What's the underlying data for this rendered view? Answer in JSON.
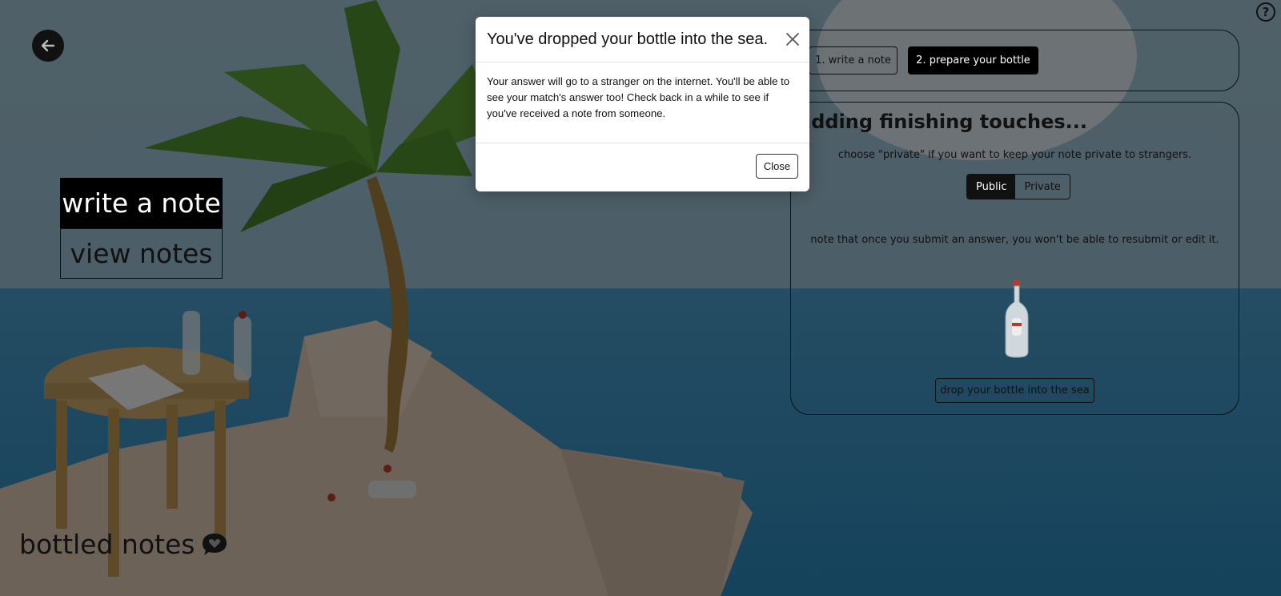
{
  "app": {
    "brand": "bottled notes",
    "help": "?"
  },
  "menu": {
    "write": "write a note",
    "view": "view notes"
  },
  "steps": [
    {
      "label": "1. write a note",
      "active": false
    },
    {
      "label": "2. prepare your bottle",
      "active": true
    }
  ],
  "form": {
    "title": "adding finishing touches...",
    "privacy_hint": "choose \"private\" if you want to keep your note private to strangers.",
    "privacy_options": [
      "Public",
      "Private"
    ],
    "privacy_selected": "Public",
    "submit_note": "note that once you submit an answer, you won't be able to resubmit or edit it.",
    "drop_button": "drop your bottle into the sea"
  },
  "modal": {
    "title": "You've dropped your bottle into the sea.",
    "body": "Your answer will go to a stranger on the internet. You'll be able to see your match's answer too! Check back in a while to see if you've received a note from someone.",
    "close_button": "Close"
  },
  "colors": {
    "sky": "#8fb6c9",
    "sea": "#3f8fbd",
    "sand": "#d8c2ad",
    "leaf": "#4f8e2e",
    "trunk": "#a37d3c"
  }
}
